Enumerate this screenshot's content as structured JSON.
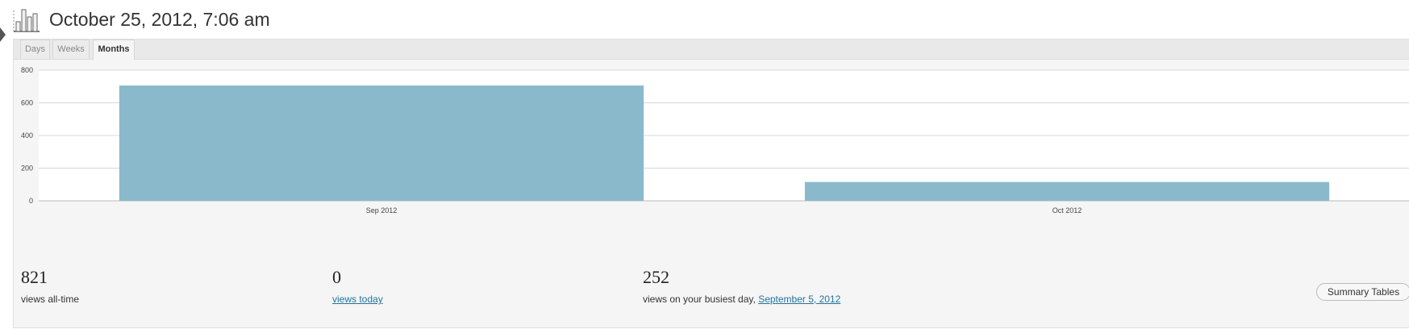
{
  "header": {
    "title": "October 25, 2012, 7:06 am",
    "icon": "stats-chart-icon"
  },
  "tabs": [
    {
      "label": "Days",
      "active": false
    },
    {
      "label": "Weeks",
      "active": false
    },
    {
      "label": "Months",
      "active": true
    }
  ],
  "chart_data": {
    "type": "bar",
    "categories": [
      "Sep 2012",
      "Oct 2012"
    ],
    "values": [
      706,
      115
    ],
    "ylim": [
      0,
      800
    ],
    "yticks": [
      0,
      200,
      400,
      600,
      800
    ],
    "grid": true,
    "bar_color": "#8bb9cc"
  },
  "stats": {
    "all_time": {
      "value": "821",
      "label": "views all-time"
    },
    "today": {
      "value": "0",
      "label": "views today"
    },
    "busiest": {
      "value": "252",
      "label": "views on your busiest day, ",
      "date": "September 5, 2012"
    }
  },
  "summary_button": {
    "label": "Summary Tables"
  }
}
